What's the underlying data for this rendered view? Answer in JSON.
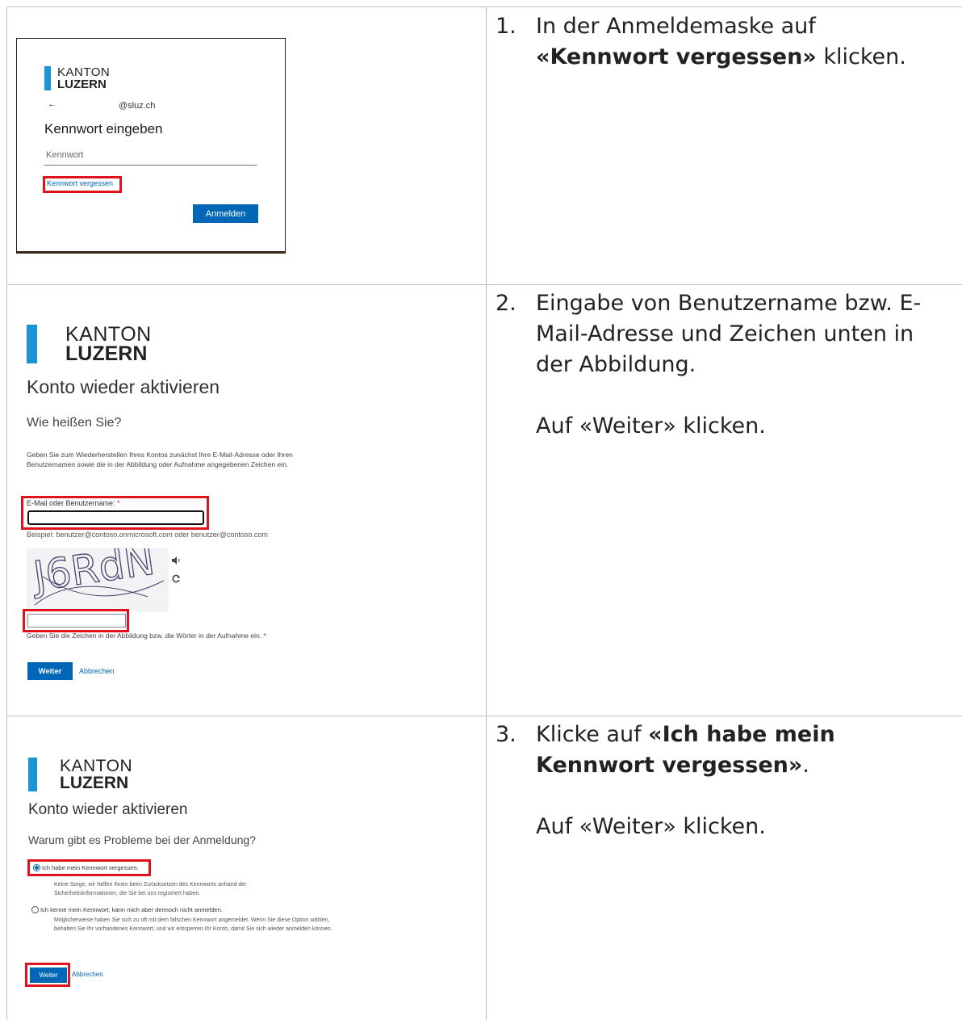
{
  "steps": [
    {
      "number": "1.",
      "text_before": "In der Anmeldemaske auf ",
      "text_bold": "«Kennwort vergessen»",
      "text_after": " klicken.",
      "screenshot": {
        "logo_line1": "KANTON",
        "logo_line2": "LUZERN",
        "back_arrow": "←",
        "account": "@sluz.ch",
        "heading": "Kennwort eingeben",
        "password_placeholder": "Kennwort",
        "forgot_link": "Kennwort vergessen",
        "signin_button": "Anmelden"
      }
    },
    {
      "number": "2.",
      "text": "Eingabe von Benutzername bzw. E-Mail-Adresse und Zeichen unten in der Abbildung.",
      "text2": "Auf «Weiter» klicken.",
      "screenshot": {
        "logo_line1": "KANTON",
        "logo_line2": "LUZERN",
        "title": "Konto wieder aktivieren",
        "subtitle": "Wie heißen Sie?",
        "description": "Geben Sie zum Wiederherstellen Ihres Kontos zunächst Ihre E-Mail-Adresse oder Ihren Benutzernamen sowie die in der Abbildung oder Aufnahme angegebenen Zeichen ein.",
        "email_label": "E-Mail oder Benutzername:",
        "required_mark": "*",
        "example": "Beispiel: benutzer@contoso.onmicrosoft.com oder benutzer@contoso.com",
        "captcha_text": "J6RdN",
        "captcha_hint": "Geben Sie die Zeichen in der Abbildung bzw. die Wörter in der Aufnahme ein.",
        "next_button": "Weiter",
        "cancel_link": "Abbrechen"
      }
    },
    {
      "number": "3.",
      "text_before": "Klicke auf ",
      "text_bold": "«Ich habe mein Kennwort vergessen»",
      "text_after": ".",
      "text2": "Auf «Weiter» klicken.",
      "screenshot": {
        "logo_line1": "KANTON",
        "logo_line2": "LUZERN",
        "title": "Konto wieder aktivieren",
        "subtitle": "Warum gibt es Probleme bei der Anmeldung?",
        "option1_label": "Ich habe mein Kennwort vergessen.",
        "option1_desc": "Keine Sorge, wir helfen Ihnen beim Zurücksetzen des Kennworts anhand der Sicherheitsinformationen, die Sie bei uns registriert haben.",
        "option2_label": "Ich kenne mein Kennwort, kann mich aber dennoch nicht anmelden.",
        "option2_desc": "Möglicherweise haben Sie sich zu oft mit dem falschen Kennwort angemeldet. Wenn Sie diese Option wählen, behalten Sie Ihr vorhandenes Kennwort, und wir entsperren Ihr Konto, damit Sie sich wieder anmelden können.",
        "next_button": "Weiter",
        "cancel_link": "Abbrechen"
      }
    }
  ],
  "colors": {
    "brand_blue": "#1a94d4",
    "button_blue": "#0067b8",
    "highlight_red": "#e0121b",
    "table_border": "#bdbdbd"
  }
}
